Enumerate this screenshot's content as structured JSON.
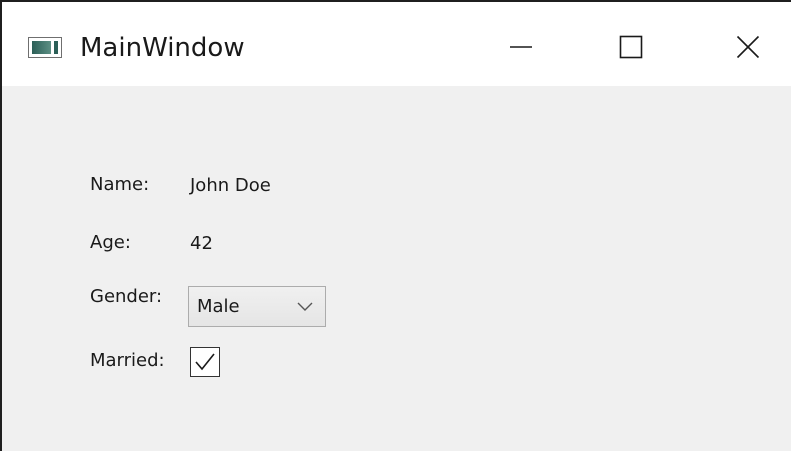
{
  "window": {
    "title": "MainWindow",
    "icon": "window-app-icon",
    "controls": {
      "minimize_icon": "minimize-icon",
      "maximize_icon": "maximize-icon",
      "close_icon": "close-icon"
    }
  },
  "form": {
    "name_label": "Name:",
    "name_value": "John Doe",
    "age_label": "Age:",
    "age_value": "42",
    "gender_label": "Gender:",
    "gender_selected": "Male",
    "married_label": "Married:",
    "married_checked": true
  },
  "colors": {
    "client_background": "#f0f0f0",
    "titlebar_background": "#ffffff",
    "text": "#1a1a1a"
  }
}
